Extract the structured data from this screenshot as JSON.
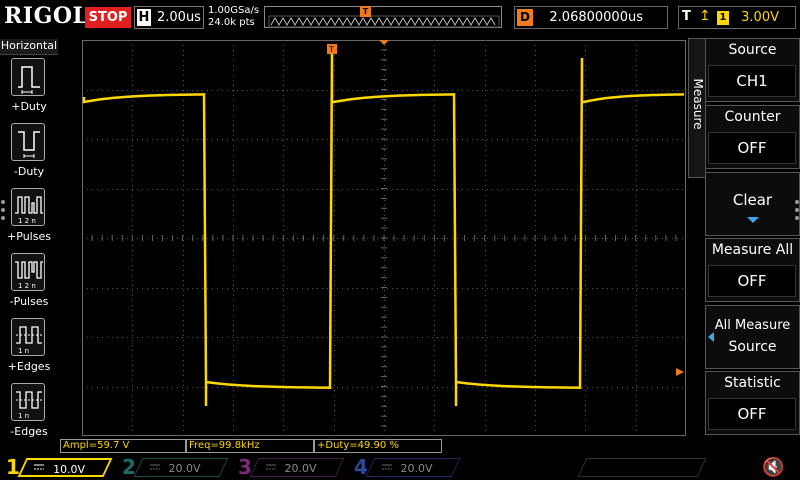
{
  "header": {
    "brand": "RIGOL",
    "run_state": "STOP",
    "horizontal": {
      "key": "H",
      "value": "2.00us"
    },
    "sample_rate": "1.00GSa/s",
    "memory_depth": "24.0k pts",
    "memory_trigger_marker": "T",
    "delay": {
      "key": "D",
      "value": "2.06800000us"
    },
    "trigger": {
      "key": "T",
      "edge_icon": "rising-edge-icon",
      "channel": "1",
      "level": "3.00V"
    }
  },
  "left_panel": {
    "title": "Horizontal",
    "items": [
      {
        "label": "+Duty",
        "icon": "pos-duty-icon"
      },
      {
        "label": "-Duty",
        "icon": "neg-duty-icon"
      },
      {
        "label": "+Pulses",
        "icon": "pos-pulses-icon"
      },
      {
        "label": "-Pulses",
        "icon": "neg-pulses-icon"
      },
      {
        "label": "+Edges",
        "icon": "pos-edges-icon"
      },
      {
        "label": "-Edges",
        "icon": "neg-edges-icon"
      }
    ],
    "icon_subtext": [
      "1 2 n",
      "1 2 n",
      "1 n",
      "1 n"
    ]
  },
  "right_menu": {
    "tab_label": "Measure",
    "keys": [
      {
        "title": "Source",
        "value": "CH1"
      },
      {
        "title": "Counter",
        "value": "OFF"
      },
      {
        "title": "Clear"
      },
      {
        "title": "Measure All",
        "value": "OFF"
      },
      {
        "title_line1": "All Measure",
        "title_line2": "Source"
      },
      {
        "title": "Statistic",
        "value": "OFF"
      }
    ]
  },
  "measurements": [
    {
      "label": "Ampl=59.7 V"
    },
    {
      "label": "Freq=99.8kHz"
    },
    {
      "label": "+Duty=49.90 %"
    }
  ],
  "waveform": {
    "channel_marker": "1",
    "trigger_marker": "T",
    "color": "#ffd700",
    "trigger_color": "#f07a20",
    "period_divisions": 5.0,
    "duty": 0.499
  },
  "channels": [
    {
      "num": "1",
      "scale": "10.0V",
      "active": true
    },
    {
      "num": "2",
      "scale": "20.0V",
      "active": false
    },
    {
      "num": "3",
      "scale": "20.0V",
      "active": false
    },
    {
      "num": "4",
      "scale": "20.0V",
      "active": false
    }
  ],
  "colors": {
    "accent": "#39a8e8",
    "ch1": "#ffd700",
    "ch2": "#1c6b6b",
    "ch3": "#7a2a7a",
    "ch4": "#2a4a9a",
    "stop": "#e02020"
  }
}
